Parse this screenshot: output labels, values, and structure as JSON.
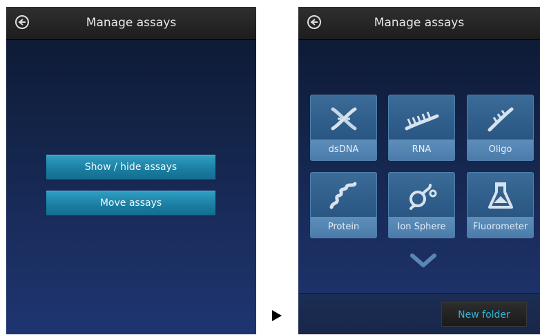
{
  "left": {
    "title": "Manage assays",
    "back_icon": "back-arrow-circle-icon",
    "buttons": [
      "Show / hide assays",
      "Move assays"
    ]
  },
  "right": {
    "title": "Manage assays",
    "back_icon": "back-arrow-circle-icon",
    "tiles": [
      {
        "label": "dsDNA",
        "icon": "dsdna-helix-icon"
      },
      {
        "label": "RNA",
        "icon": "rna-strand-icon"
      },
      {
        "label": "Oligo",
        "icon": "oligo-strand-icon"
      },
      {
        "label": "Protein",
        "icon": "protein-coil-icon"
      },
      {
        "label": "Ion Sphere",
        "icon": "ion-sphere-icon"
      },
      {
        "label": "Fluorometer",
        "icon": "fluorometer-flask-icon"
      }
    ],
    "more_icon": "chevron-down-icon",
    "new_folder_label": "New folder"
  },
  "transition_icon": "triangle-right-icon",
  "colors": {
    "accent": "#1b7fa3",
    "tile": "#2b5885",
    "new_folder_text": "#30b6dd"
  }
}
